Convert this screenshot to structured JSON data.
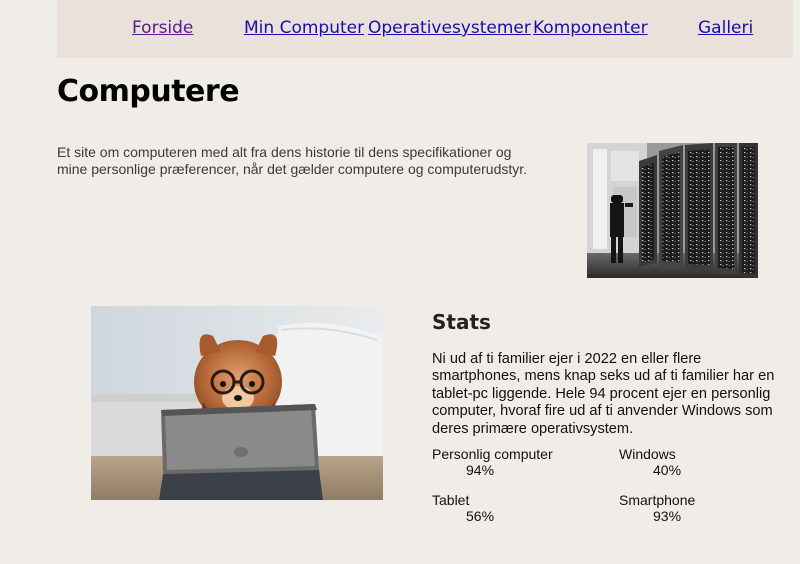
{
  "nav": {
    "items": [
      {
        "label": "Forside"
      },
      {
        "label": "Min Computer"
      },
      {
        "label": "Operativesystemer"
      },
      {
        "label": "Komponenter"
      },
      {
        "label": "Galleri"
      }
    ]
  },
  "header": {
    "title": "Computere"
  },
  "intro": {
    "text": "Et site om computeren med alt fra dens historie til dens specifikationer og mine personlige præferencer, når det gælder computere og computerudstyr."
  },
  "stats": {
    "title": "Stats",
    "text": "Ni ud af ti familier ejer i 2022 en eller flere smartphones, mens knap seks ud af ti familier har en tablet-pc liggende. Hele 94 procent ejer en personlig computer, hvoraf fire ud af ti anvender Windows som deres primære operativsystem.",
    "items": [
      {
        "label": "Personlig computer",
        "value": "94%"
      },
      {
        "label": "Windows",
        "value": "40%"
      },
      {
        "label": "Tablet",
        "value": "56%"
      },
      {
        "label": "Smartphone",
        "value": "93%"
      }
    ]
  }
}
